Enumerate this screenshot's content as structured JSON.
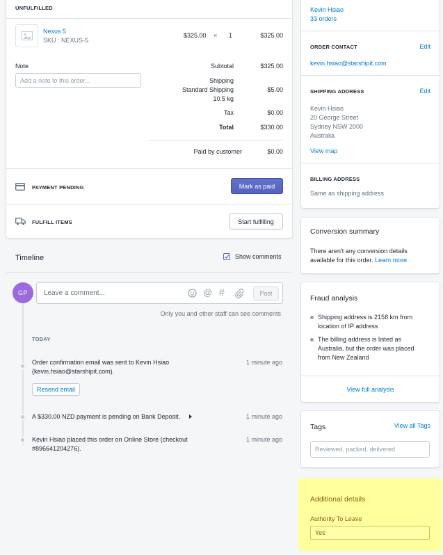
{
  "order": {
    "unfulfilled_label": "UNFULFILLED",
    "item_name": "Nexus 5",
    "item_sku": "SKU : NEXUS-5",
    "item_price": "$325.00",
    "times": "×",
    "item_qty": "1",
    "item_total": "$325.00",
    "note_label": "Note",
    "note_placeholder": "Add a note to this order...",
    "subtotal_label": "Subtotal",
    "subtotal": "$325.00",
    "shipping_label": "Shipping",
    "shipping_method": "Standard Shipping",
    "shipping_weight": "10.5 kg",
    "shipping": "$5.00",
    "tax_label": "Tax",
    "tax": "$0.00",
    "total_label": "Total",
    "total": "$330.00",
    "paid_label": "Paid by customer",
    "paid": "$0.00",
    "payment_pending": "PAYMENT PENDING",
    "mark_paid": "Mark as paid",
    "fulfill_items": "FULFILL ITEMS",
    "start_fulfilling": "Start fulfilling"
  },
  "timeline": {
    "title": "Timeline",
    "show_comments": "Show comments",
    "avatar": "GP",
    "comment_placeholder": "Leave a comment...",
    "post": "Post",
    "staff_note": "Only you and other staff can see comments",
    "today": "TODAY",
    "events": [
      {
        "line1": "Order confirmation email was sent to Kevin Hsiao",
        "line2": "(kevin.hsiao@starshipit.com).",
        "time": "1 minute ago"
      },
      {
        "line1": "A $330.00 NZD payment is pending on Bank Deposit.",
        "time": "1 minute ago"
      },
      {
        "line1": "Kevin Hsiao placed this order on Online Store (checkout",
        "line2": "#896641204276).",
        "time": "1 minute ago"
      }
    ],
    "resend_email": "Resend email"
  },
  "customer": {
    "name": "Kevin Hsiao",
    "orders": "33 orders",
    "contact_label": "ORDER CONTACT",
    "edit": "Edit",
    "email": "kevin.hsiao@starshipit.com",
    "shipping_label": "SHIPPING ADDRESS",
    "addr1": "Kevin Hsiao",
    "addr2": "20 George Street",
    "addr3": "Sydney NSW 2000",
    "addr4": "Australia",
    "view_map": "View map",
    "billing_label": "BILLING ADDRESS",
    "billing_value": "Same as shipping address"
  },
  "conversion": {
    "title": "Conversion summary",
    "text1": "There aren't any conversion details",
    "text2": "available for this order.",
    "learn_more": "Learn more"
  },
  "fraud": {
    "title": "Fraud analysis",
    "b1l1": "Shipping address is 2158 km from",
    "b1l2": "location of IP address",
    "b2l1": "The billing address is listed as",
    "b2l2": "Australia, but the order was placed",
    "b2l3": "from New Zealand",
    "view_full": "View full analysis"
  },
  "tags": {
    "title": "Tags",
    "view_all": "View all Tags",
    "placeholder": "Reviewed, packed, delivered"
  },
  "additional": {
    "title": "Additional details",
    "field_label": "Authority To Leave",
    "field_value": "Yes"
  },
  "colors": {
    "accent": "#5c6ac4",
    "link": "#007ace",
    "highlight": "#ffff9e",
    "avatar": "#9c6ade"
  }
}
